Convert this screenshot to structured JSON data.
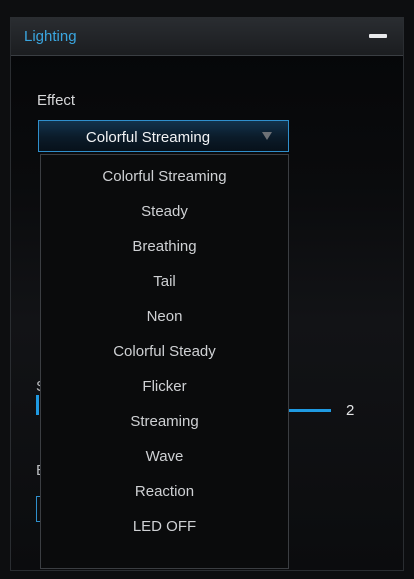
{
  "panel": {
    "title": "Lighting",
    "collapse_icon": "minus-icon"
  },
  "effect": {
    "label": "Effect",
    "selected": "Colorful Streaming",
    "arrow_icon": "triangle-down-icon",
    "options": [
      "Colorful Streaming",
      "Steady",
      "Breathing",
      "Tail",
      "Neon",
      "Colorful Steady",
      "Flicker",
      "Streaming",
      "Wave",
      "Reaction",
      "LED OFF"
    ]
  },
  "speed": {
    "partial_label": "S",
    "value": "2"
  },
  "brightness": {
    "partial_label": "B"
  },
  "colors": {
    "accent": "#1f9ae2",
    "title": "#3aa6e0"
  }
}
